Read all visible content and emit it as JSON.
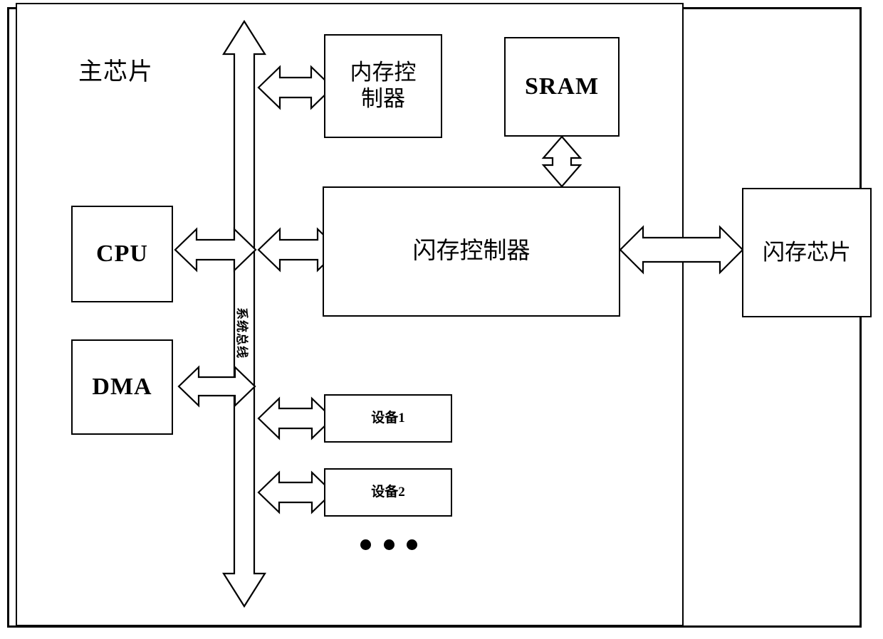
{
  "diagram": {
    "title_main_chip": "主芯片",
    "bus_label": "系统总线",
    "blocks": {
      "memory_controller": "内存控\n制器",
      "sram": "SRAM",
      "flash_controller": "闪存控制器",
      "flash_chip": "闪存芯片",
      "cpu": "CPU",
      "dma": "DMA",
      "device1": "设备1",
      "device2": "设备2"
    },
    "ellipsis": "• • •",
    "colors": {
      "stroke": "#000000",
      "fill": "#ffffff"
    },
    "connections": [
      {
        "from": "system-bus",
        "to": "memory_controller",
        "style": "double-arrow-horizontal"
      },
      {
        "from": "system-bus",
        "to": "cpu",
        "style": "double-arrow-horizontal"
      },
      {
        "from": "system-bus",
        "to": "dma",
        "style": "double-arrow-horizontal"
      },
      {
        "from": "system-bus",
        "to": "flash_controller",
        "style": "double-arrow-horizontal"
      },
      {
        "from": "system-bus",
        "to": "device1",
        "style": "double-arrow-horizontal"
      },
      {
        "from": "system-bus",
        "to": "device2",
        "style": "double-arrow-horizontal"
      },
      {
        "from": "sram",
        "to": "flash_controller",
        "style": "double-arrow-vertical"
      },
      {
        "from": "flash_controller",
        "to": "flash_chip",
        "style": "double-arrow-horizontal"
      }
    ]
  }
}
